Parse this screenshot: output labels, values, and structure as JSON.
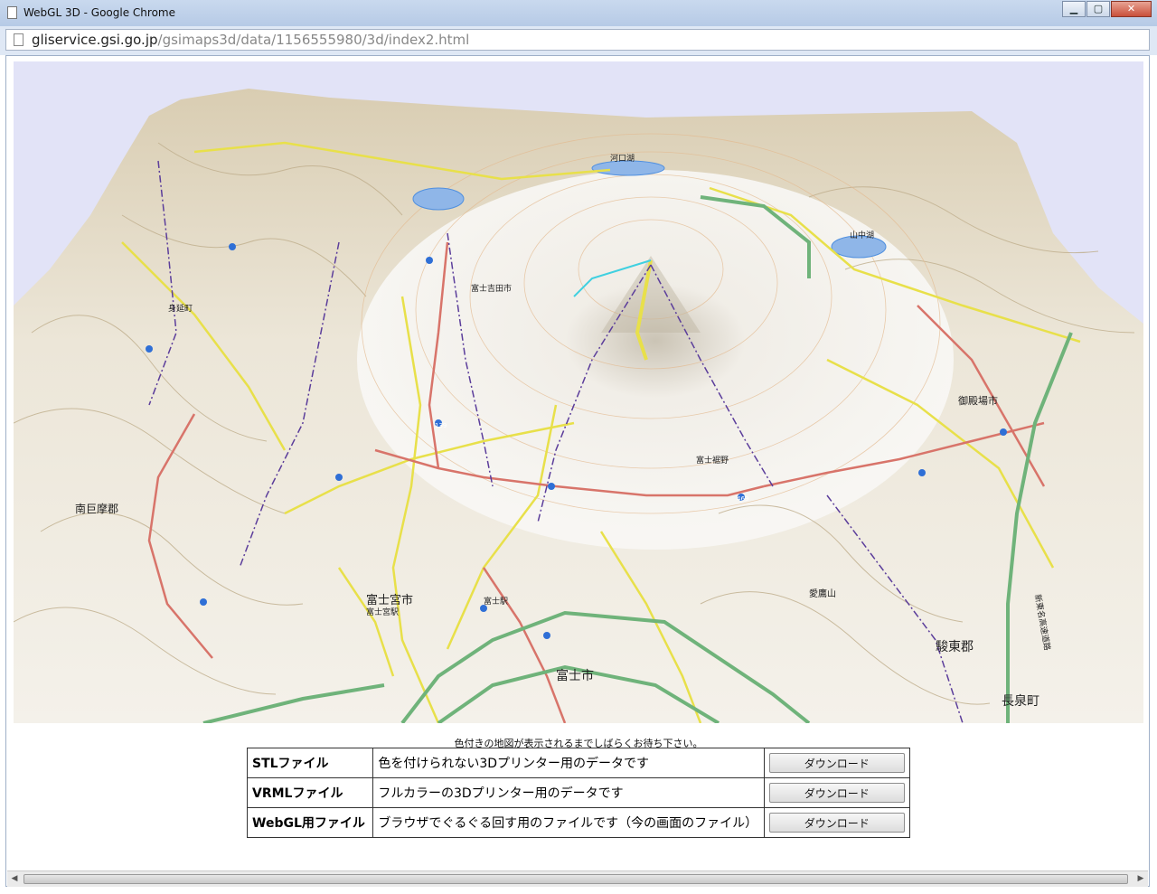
{
  "window": {
    "title": "WebGL 3D - Google Chrome",
    "buttons": [
      "minimize",
      "maximize",
      "close"
    ]
  },
  "address_bar": {
    "host": "gliservice.gsi.go.jp",
    "path": "/gsimaps3d/data/1156555980/3d/index2.html"
  },
  "map": {
    "description_labels": {
      "city_fujinomiya": "富士宮市",
      "city_fuji": "富士市",
      "city_fujiyoshida": "富士吉田市",
      "city_gotemba": "御殿場市",
      "district_sunto": "駿東郡",
      "district_minamikoma": "南巨摩郡",
      "town_nagaizumi": "長泉町",
      "town_minobu": "身延町",
      "station_fujinomiya": "富士宮駅",
      "station_fuji": "富士駅",
      "lake_kawaguchi": "河口湖",
      "lake_yamanaka": "山中湖",
      "mt_ashitaka": "愛鷹山",
      "highway_shin_tomei": "新東名高速道路",
      "plain_fuji": "富士裾野",
      "road_route_139": "139",
      "road_route_469": "469"
    },
    "colors": {
      "sky": "#e2e3f7",
      "terrain": "#efeadf",
      "ridge": "#c7b89a",
      "road_yellow": "#e8e04a",
      "road_red": "#d8746a",
      "expressway": "#6fb37a",
      "boundary": "#5b3d9b",
      "water": "#4f8fdf"
    }
  },
  "notice": "色付きの地図が表示されるまでしばらくお待ち下さい。",
  "downloads": [
    {
      "name": "STLファイル",
      "desc": "色を付けられない3Dプリンター用のデータです",
      "button": "ダウンロード"
    },
    {
      "name": "VRMLファイル",
      "desc": "フルカラーの3Dプリンター用のデータです",
      "button": "ダウンロード"
    },
    {
      "name": "WebGL用ファイル",
      "desc": "ブラウザでぐるぐる回す用のファイルです（今の画面のファイル）",
      "button": "ダウンロード"
    }
  ]
}
